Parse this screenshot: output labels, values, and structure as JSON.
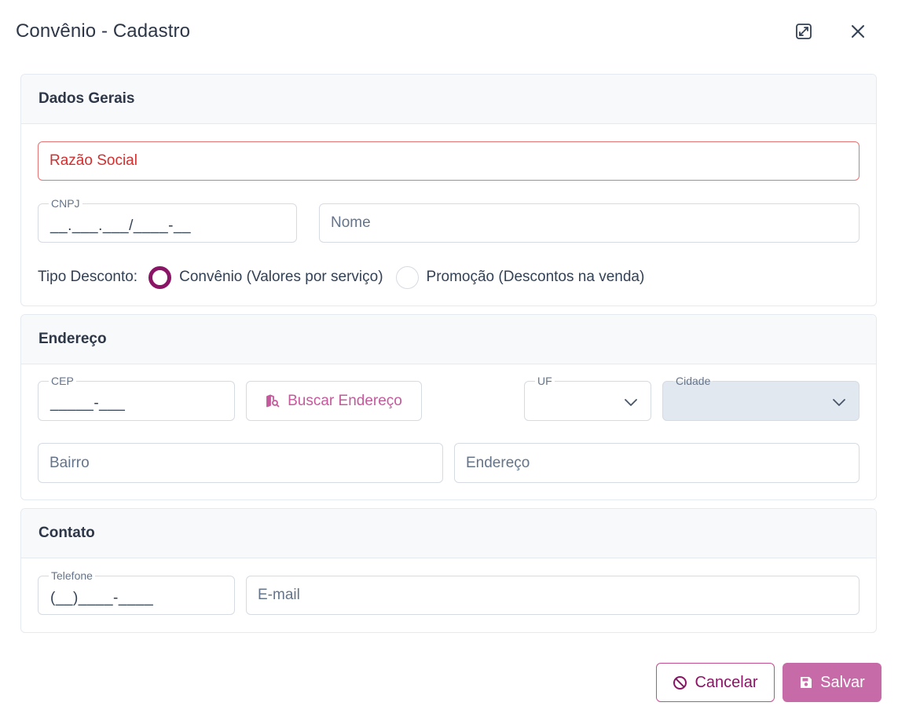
{
  "dialog": {
    "title": "Convênio - Cadastro"
  },
  "sections": {
    "general": {
      "title": "Dados Gerais",
      "razao_social_placeholder": "Razão Social",
      "cnpj_label": "CNPJ",
      "cnpj_mask": "__.___.___/____-__",
      "nome_placeholder": "Nome",
      "tipo_desconto_label": "Tipo Desconto:",
      "tipo_desconto_options": [
        {
          "label": "Convênio (Valores por serviço)",
          "selected": true
        },
        {
          "label": "Promoção (Descontos na venda)",
          "selected": false
        }
      ]
    },
    "address": {
      "title": "Endereço",
      "cep_label": "CEP",
      "cep_mask": "_____-___",
      "search_button": "Buscar Endereço",
      "uf_label": "UF",
      "cidade_label": "Cidade",
      "bairro_placeholder": "Bairro",
      "endereco_placeholder": "Endereço"
    },
    "contact": {
      "title": "Contato",
      "telefone_label": "Telefone",
      "telefone_mask": "(__)____-____",
      "email_placeholder": "E-mail"
    }
  },
  "footer": {
    "cancel_label": "Cancelar",
    "save_label": "Salvar"
  },
  "colors": {
    "accent": "#8a1465",
    "accent_light": "#c76aa8",
    "error": "#d32f2f",
    "disabled_bg": "#e2e8f0"
  },
  "icons": {
    "expand": "expand-icon",
    "close": "close-icon",
    "search_map": "map-search-icon",
    "cancel": "ban-icon",
    "save": "floppy-disk-icon",
    "dropdown": "chevron-down-icon"
  }
}
